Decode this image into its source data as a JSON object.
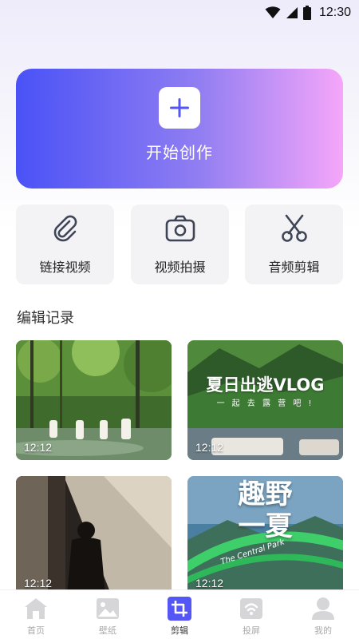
{
  "status_bar": {
    "time": "12:30"
  },
  "hero": {
    "label": "开始创作"
  },
  "tools": [
    {
      "label": "链接视频",
      "icon": "paperclip-icon"
    },
    {
      "label": "视频拍摄",
      "icon": "camera-icon"
    },
    {
      "label": "音频剪辑",
      "icon": "scissors-icon"
    }
  ],
  "section": {
    "title": "编辑记录"
  },
  "records": [
    {
      "duration": "12:12"
    },
    {
      "duration": "12:12",
      "overlay_title": "夏日出逃VLOG",
      "overlay_subtitle": "一 起 去 露 营 吧 !"
    },
    {
      "duration": "12:12"
    },
    {
      "duration": "12:12",
      "overlay_title_line1": "趣野",
      "overlay_title_line2": "一夏",
      "overlay_script": "The Central Park"
    }
  ],
  "tabbar": {
    "items": [
      {
        "label": "首页",
        "icon": "home-icon",
        "active": false
      },
      {
        "label": "壁纸",
        "icon": "image-icon",
        "active": false
      },
      {
        "label": "剪辑",
        "icon": "crop-icon",
        "active": true
      },
      {
        "label": "投屏",
        "icon": "cast-icon",
        "active": false
      },
      {
        "label": "我的",
        "icon": "user-icon",
        "active": false
      }
    ]
  },
  "colors": {
    "accent": "#5457f5",
    "hero_gradient_start": "#4a52f6",
    "hero_gradient_end": "#f5a6f9",
    "tool_bg": "#f3f3f6",
    "tab_inactive": "#d6d6d9"
  }
}
